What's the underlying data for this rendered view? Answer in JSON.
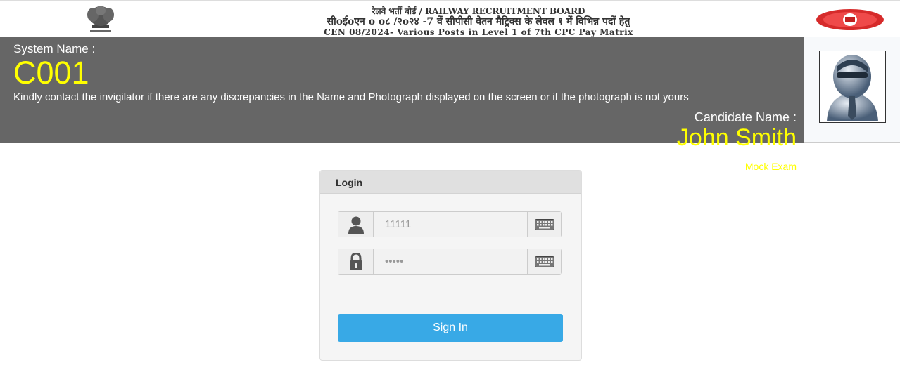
{
  "header": {
    "line1": "रेलवे भर्ती बोर्ड / RAILWAY RECRUITMENT BOARD",
    "line2": "सीoईoएन o  o८ /२o२४ -7 वें सीपीसी वेतन मैट्रिक्स के लेवल १ में विभिन्न पदों हेतु",
    "line3": "CEN 08/2024- Various Posts in Level 1 of 7th CPC Pay Matrix",
    "emblem_icon": "national-emblem-icon",
    "logo_icon": "indian-railways-logo-icon"
  },
  "banner": {
    "system_label": "System Name :",
    "system_value": "C001",
    "notice": "Kindly contact the invigilator if there are any discrepancies in the Name and Photograph displayed on the screen or if the photograph is not yours",
    "candidate_label": "Candidate Name :",
    "candidate_value": "John Smith",
    "mode": "Mock Exam",
    "highlight_color": "#ffff00",
    "background_color": "#666666"
  },
  "login": {
    "title": "Login",
    "username_value": "11111",
    "password_value": "•••••",
    "signin_label": "Sign In",
    "button_color": "#38a9e6",
    "user_icon": "user-icon",
    "lock_icon": "lock-icon",
    "keyboard_icon": "keyboard-icon"
  }
}
